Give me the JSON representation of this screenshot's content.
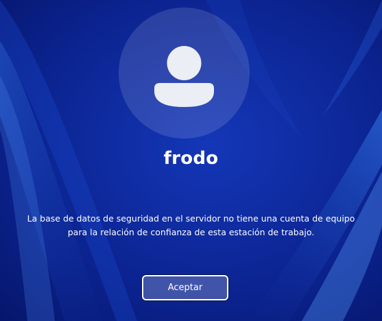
{
  "user": {
    "name": "frodo",
    "avatar_icon": "user-silhouette-icon"
  },
  "message": {
    "line1": "La base de datos de seguridad en el servidor no tiene una cuenta de equipo",
    "line2": "para la relación de confianza de esta estación de trabajo."
  },
  "actions": {
    "ok_label": "Aceptar"
  },
  "colors": {
    "background": "#0a1f8f",
    "text": "#ffffff"
  }
}
